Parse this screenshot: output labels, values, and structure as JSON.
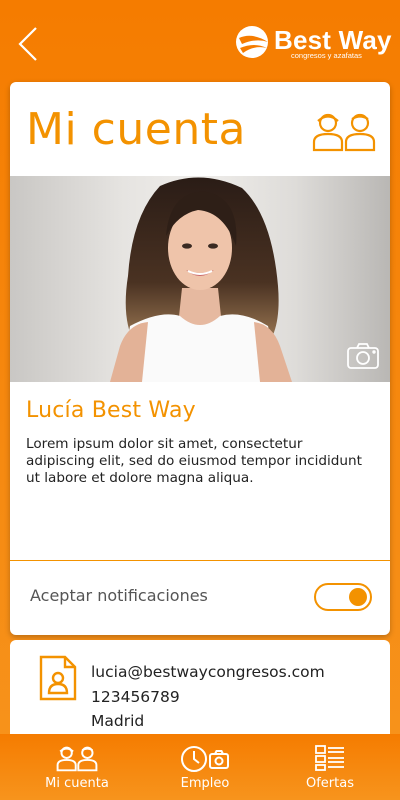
{
  "header": {
    "back_icon": "chevron-left-icon",
    "logo_title": "Best Way",
    "logo_subtitle": "congresos y azafatas"
  },
  "card": {
    "title": "Mi cuenta",
    "title_icon": "users-pair-icon",
    "camera_icon": "camera-icon",
    "user_name": "Lucía Best Way",
    "bio": "Lorem ipsum dolor sit amet, consectetur adipiscing elit, sed do eiusmod tempor incididunt ut labore et dolore magna aliqua.",
    "notifications_label": "Aceptar notificaciones",
    "notifications_enabled": true
  },
  "contact": {
    "icon": "contact-card-icon",
    "email": "lucia@bestwaycongresos.com",
    "phone": "123456789",
    "city": "Madrid"
  },
  "bottom_nav": [
    {
      "label": "Mi cuenta",
      "icon": "users-pair-icon"
    },
    {
      "label": "Empleo",
      "icon": "clock-camera-icon"
    },
    {
      "label": "Ofertas",
      "icon": "list-grid-icon"
    }
  ],
  "colors": {
    "accent": "#f39200",
    "header_bg": "#f57c00",
    "text": "#222222",
    "white": "#ffffff"
  }
}
